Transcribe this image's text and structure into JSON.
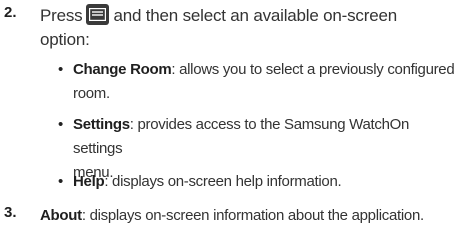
{
  "step2": {
    "number": "2.",
    "text_before": "Press",
    "icon": "menu-key-icon",
    "text_after_line1": "and then select an available on-screen",
    "text_line2": "option:"
  },
  "bullets": [
    {
      "term": "Change Room",
      "desc_line1": ": allows you to select a previously configured",
      "desc_line2": "room."
    },
    {
      "term": "Settings",
      "desc_line1": ": provides access to the Samsung WatchOn settings",
      "desc_line2": "menu."
    },
    {
      "term": "Help",
      "desc_line1": ": displays on-screen help information."
    }
  ],
  "step3": {
    "number": "3.",
    "term": "About",
    "desc": ": displays on-screen information about the application."
  }
}
